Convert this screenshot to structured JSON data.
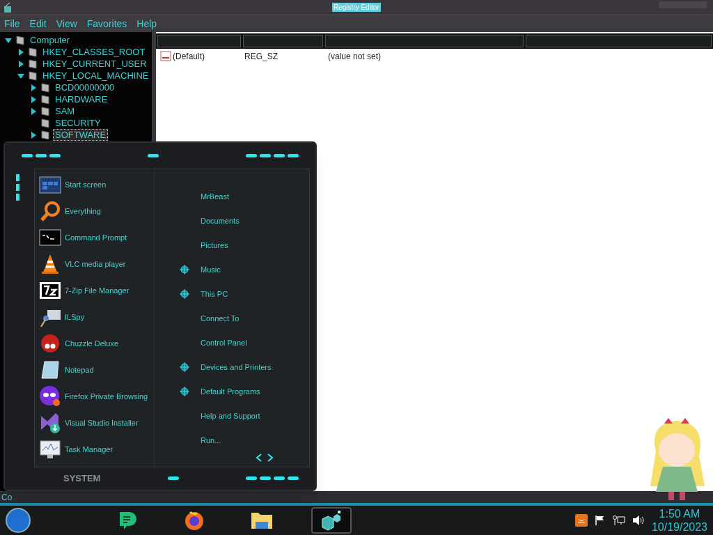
{
  "window": {
    "title": "Registry Editor"
  },
  "menu_bar": [
    "File",
    "Edit",
    "View",
    "Favorites",
    "Help"
  ],
  "tree": [
    {
      "label": "Computer",
      "expanded": true,
      "selected": false,
      "children": [
        {
          "label": "HKEY_CLASSES_ROOT",
          "expanded": false,
          "selected": false
        },
        {
          "label": "HKEY_CURRENT_USER",
          "expanded": false,
          "selected": false
        },
        {
          "label": "HKEY_LOCAL_MACHINE",
          "expanded": true,
          "selected": false,
          "children": [
            {
              "label": "BCD00000000",
              "expanded": false,
              "selected": false
            },
            {
              "label": "HARDWARE",
              "expanded": false,
              "selected": false
            },
            {
              "label": "SAM",
              "expanded": false,
              "selected": false
            },
            {
              "label": "SECURITY",
              "selected": false
            },
            {
              "label": "SOFTWARE",
              "expanded": false,
              "selected": true
            }
          ]
        }
      ]
    }
  ],
  "list": {
    "rows": [
      {
        "name": "(Default)",
        "type": "REG_SZ",
        "data": "(value not set)"
      }
    ]
  },
  "status_bar": "Co",
  "start_menu": {
    "programs": [
      "Start screen",
      "Everything",
      "Command Prompt",
      "VLC media player",
      "7-Zip File Manager",
      "ILSpy",
      "Chuzzle Deluxe",
      "Notepad",
      "Firefox Private Browsing",
      "Visual Studio Installer",
      "Task Manager"
    ],
    "places": [
      {
        "label": "MrBeast",
        "marked": false
      },
      {
        "label": "Documents",
        "marked": false
      },
      {
        "label": "Pictures",
        "marked": false
      },
      {
        "label": "Music",
        "marked": true
      },
      {
        "label": "This PC",
        "marked": true
      },
      {
        "label": "Connect To",
        "marked": false
      },
      {
        "label": "Control Panel",
        "marked": false
      },
      {
        "label": "Devices and Printers",
        "marked": true
      },
      {
        "label": "Default Programs",
        "marked": true
      },
      {
        "label": "Help and Support",
        "marked": false
      },
      {
        "label": "Run...",
        "marked": false
      }
    ],
    "frame_label": "SYSTEM"
  },
  "taskbar": {
    "apps": [
      {
        "selected": false
      },
      {
        "selected": false
      },
      {
        "selected": false
      },
      {
        "selected": true
      }
    ],
    "clock": {
      "time": "1:50 AM",
      "date": "10/19/2023"
    }
  }
}
